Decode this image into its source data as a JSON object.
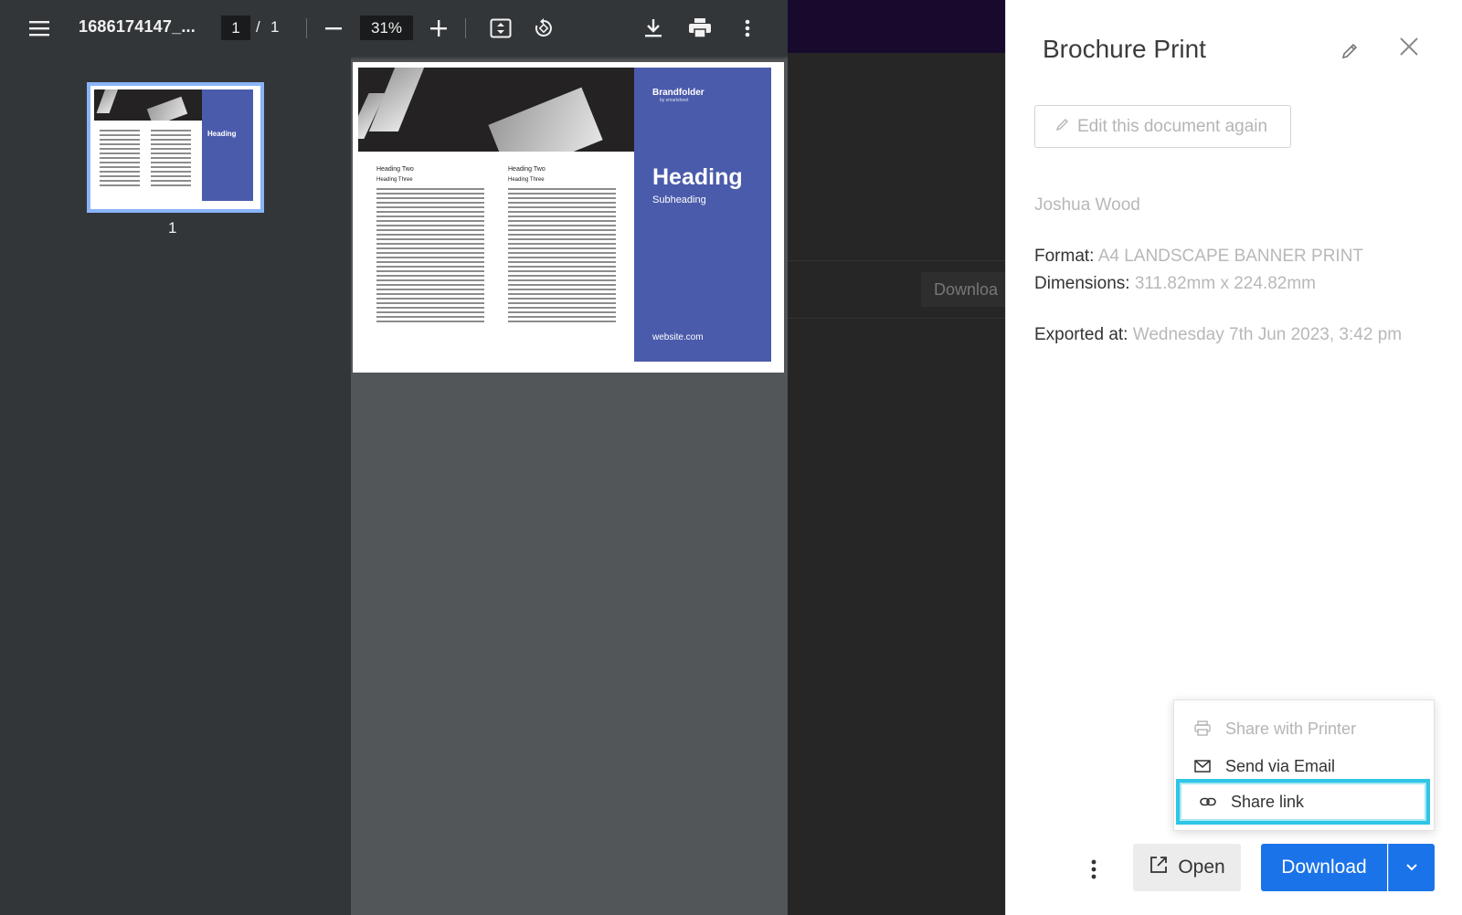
{
  "pdf_viewer": {
    "file_name": "1686174147_...",
    "current_page": "1",
    "page_separator": "/",
    "total_pages": "1",
    "zoom": "31%",
    "thumbnail_label": "1"
  },
  "brochure": {
    "brand": "Brandfolder",
    "brand_sub": "by smartsheet",
    "heading": "Heading",
    "subheading": "Subheading",
    "website": "website.com",
    "col1_heading2": "Heading Two",
    "col1_heading3": "Heading Three",
    "col2_heading2": "Heading Two",
    "col2_heading3": "Heading Three",
    "panel_color": "#4b5bab"
  },
  "backdrop": {
    "download_partial": "Downloa"
  },
  "panel": {
    "title": "Brochure Print",
    "edit_again_label": "Edit this document again",
    "author": "Joshua Wood",
    "format_label": "Format:",
    "format_value": "A4 LANDSCAPE BANNER PRINT",
    "dimensions_label": "Dimensions:",
    "dimensions_value": "311.82mm x 224.82mm",
    "exported_label": "Exported at:",
    "exported_value": "Wednesday 7th Jun 2023, 3:42 pm"
  },
  "share_menu": {
    "items": [
      {
        "label": "Share with Printer",
        "icon": "printer-icon",
        "disabled": true
      },
      {
        "label": "Send via Email",
        "icon": "mail-icon"
      },
      {
        "label": "Share link",
        "icon": "link-icon",
        "highlighted": true
      }
    ]
  },
  "actions": {
    "open_label": "Open",
    "download_label": "Download"
  },
  "colors": {
    "accent": "#1a73e8",
    "highlight": "#2ec5e6",
    "toolbar": "#323639"
  }
}
